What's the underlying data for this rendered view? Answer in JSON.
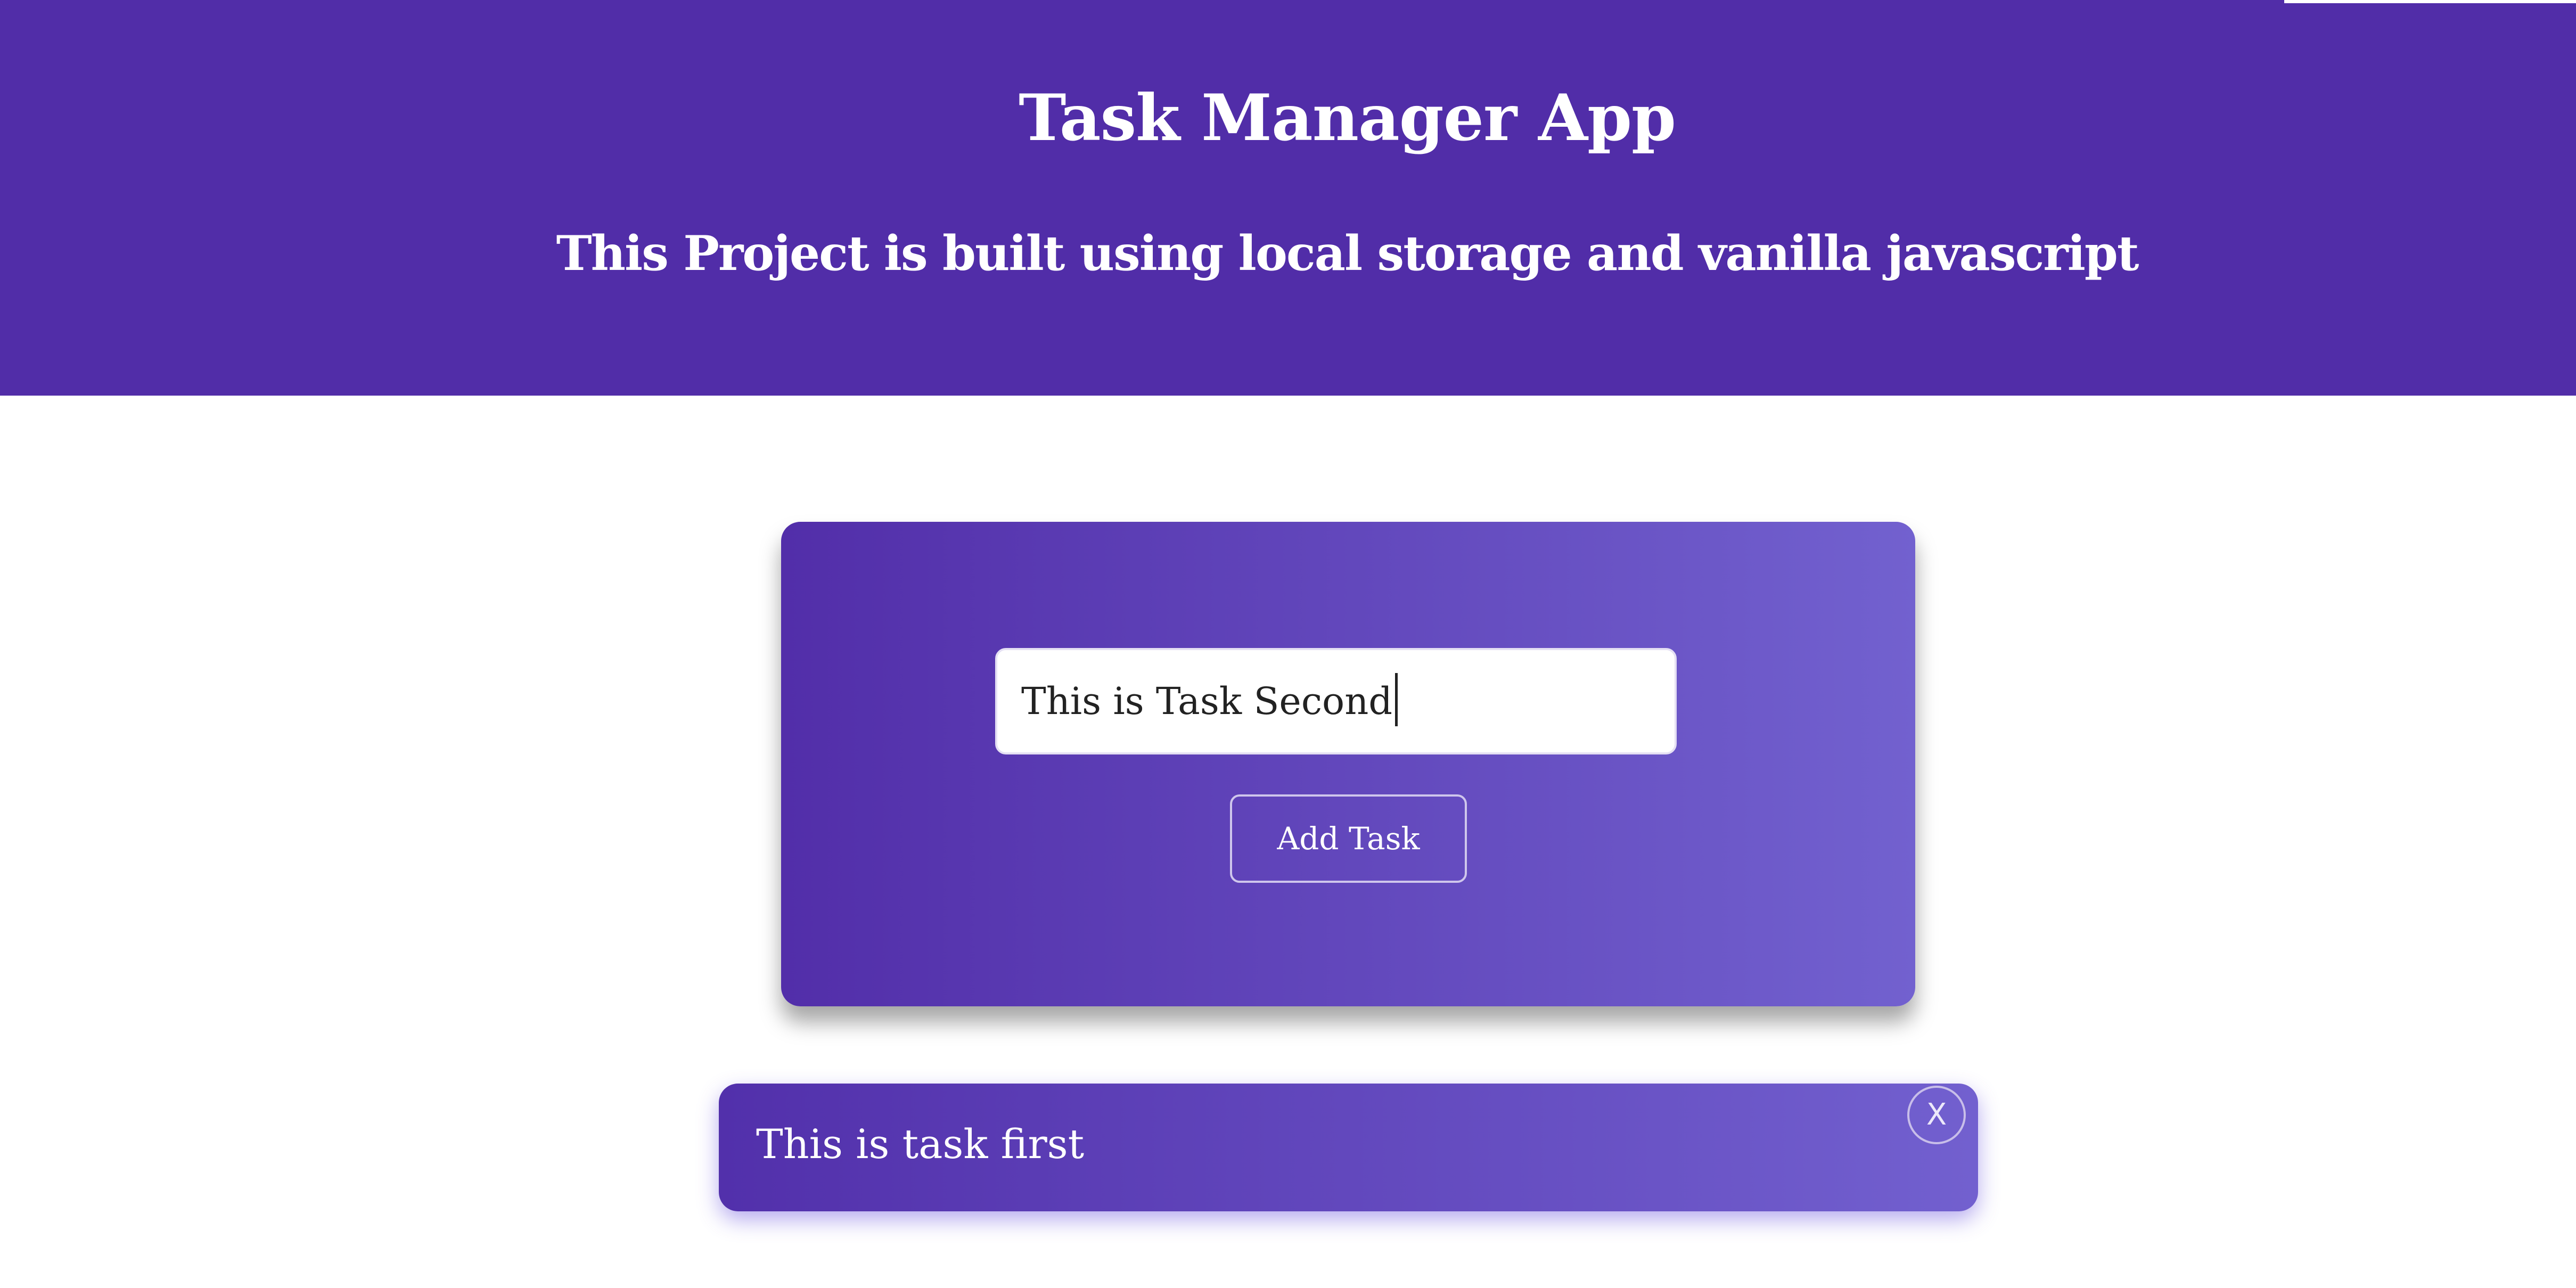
{
  "header": {
    "title": "Task Manager App",
    "subtitle": "This Project is built using local storage and vanilla javascript"
  },
  "task_form": {
    "input_value": "This is Task Second",
    "add_button_label": "Add Task"
  },
  "tasks": [
    {
      "text": "This is task first",
      "delete_label": "X"
    }
  ],
  "colors": {
    "header_background": "#512da8",
    "card_gradient_start": "#522ea9",
    "card_gradient_end": "#7261cf",
    "text_light": "#ffffff"
  },
  "icons": {
    "delete": "close-icon"
  }
}
